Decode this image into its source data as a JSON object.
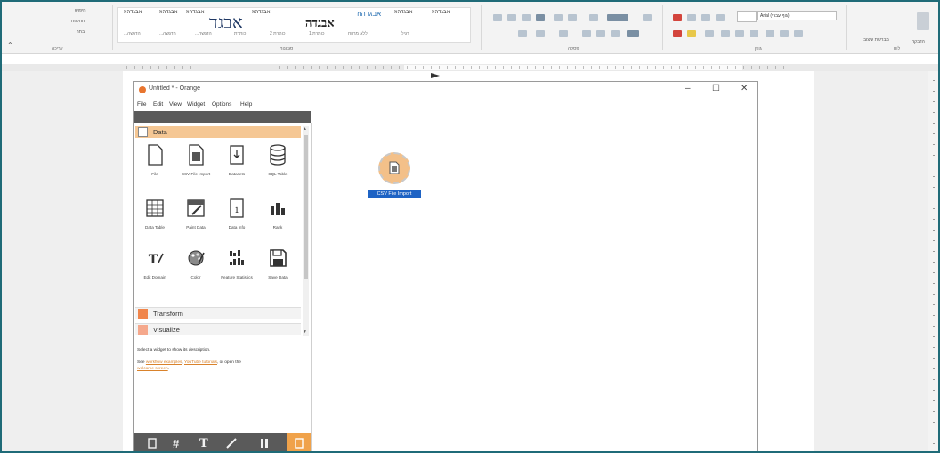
{
  "ribbon": {
    "group_labels": {
      "editing": "עריכה",
      "styles": "סגנונות",
      "paragraph": "פסקה",
      "font": "גופן",
      "clipboard": "לוח"
    },
    "find_label": "חיפוש",
    "replace_label": "החלפה",
    "select_label": "בחר",
    "style_items": [
      "אבגדהוז",
      "אבגדהוז",
      "אבגדהוז",
      "אבגד",
      "אבגדהוז",
      "אבגדה",
      "אבגדהוז",
      "אבגדהוז",
      "אבגדהוז"
    ],
    "style_subs": [
      "...הדגשה",
      "...הדגשה",
      "...הדגשה",
      "כותרת",
      "2 כותרת",
      "1 כותרת",
      "ללא מרווח",
      "רגיל"
    ],
    "font_name": "Arial (גוף עברי)",
    "paste_label": "הדבקה",
    "format_painter_label": "מברשת עיצוב"
  },
  "window": {
    "title": "Untitled * - Orange",
    "menu": [
      "File",
      "Edit",
      "View",
      "Widget",
      "Options",
      "Help"
    ],
    "controls": [
      "–",
      "☐",
      "✕"
    ]
  },
  "categories": {
    "data": "Data",
    "transform": "Transform",
    "visualize": "Visualize"
  },
  "widgets": [
    {
      "name": "File",
      "icon": "file-icon"
    },
    {
      "name": "CSV File Import",
      "icon": "csv-file-icon"
    },
    {
      "name": "Datasets",
      "icon": "datasets-icon"
    },
    {
      "name": "SQL Table",
      "icon": "database-icon"
    },
    {
      "name": "Data Table",
      "icon": "table-icon"
    },
    {
      "name": "Paint Data",
      "icon": "paint-data-icon"
    },
    {
      "name": "Data Info",
      "icon": "info-icon"
    },
    {
      "name": "Rank",
      "icon": "rank-icon"
    },
    {
      "name": "Edit Domain",
      "icon": "edit-domain-icon"
    },
    {
      "name": "Color",
      "icon": "palette-icon"
    },
    {
      "name": "Feature Statistics",
      "icon": "feature-stats-icon"
    },
    {
      "name": "Save Data",
      "icon": "save-icon"
    }
  ],
  "description": {
    "line1": "Select a widget to show its description.",
    "line2_pre": "See ",
    "link1": "workflow examples",
    "sep": ", ",
    "link2": "YouTube tutorials",
    "line2_post": ", or open the",
    "link3": "welcome screen",
    "line3_post": "."
  },
  "bottom_bar": [
    "info-icon",
    "grid-icon",
    "text-icon",
    "arrow-icon",
    "pause-icon",
    "help-icon"
  ],
  "canvas": {
    "node_label": "CSV File Import",
    "node_icon": "csv-file-icon"
  },
  "colors": {
    "orange_accent": "#f5c794",
    "transform": "#f0854b",
    "visualize": "#f5a88c",
    "selection": "#1e63c4",
    "border": "#1f6b78"
  }
}
